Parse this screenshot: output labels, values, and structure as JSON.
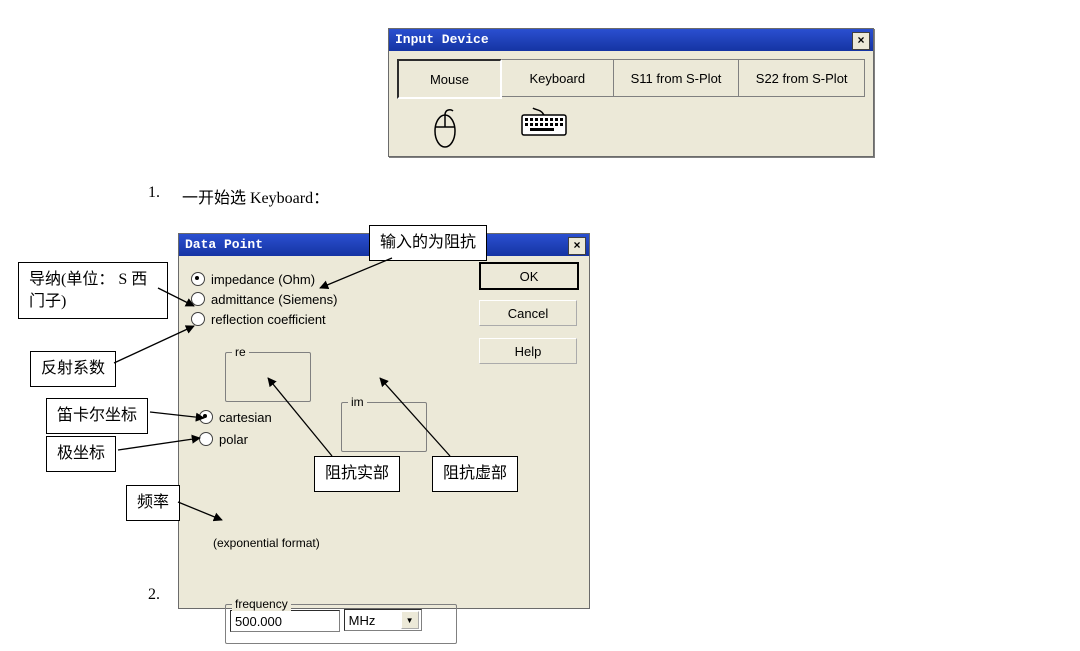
{
  "inputdev": {
    "title": "Input Device",
    "tabs": [
      "Mouse",
      "Keyboard",
      "S11 from S-Plot",
      "S22 from S-Plot"
    ]
  },
  "list": {
    "item1_num": "1.",
    "item1_text": "一开始选 Keyboard：",
    "item2_num": "2."
  },
  "datapoint": {
    "title": "Data Point",
    "radio_type": {
      "impedance": "impedance (Ohm)",
      "admittance": "admittance (Siemens)",
      "refl": "reflection coefficient"
    },
    "re_label": "re",
    "im_label": "im",
    "radio_coord": {
      "cartesian": "cartesian",
      "polar": "polar"
    },
    "freq_label": "frequency",
    "freq_value": "500.000",
    "freq_unit": "MHz",
    "exp_label": "(exponential format)",
    "buttons": {
      "ok": "OK",
      "cancel": "Cancel",
      "help": "Help"
    }
  },
  "anno": {
    "impedance_hint": "输入的为阻抗",
    "admittance": "导纳(单位： S 西门子)",
    "refl": "反射系数",
    "cartesian": "笛卡尔坐标",
    "polar": "极坐标",
    "freq": "频率",
    "re": "阻抗实部",
    "im": "阻抗虚部"
  }
}
